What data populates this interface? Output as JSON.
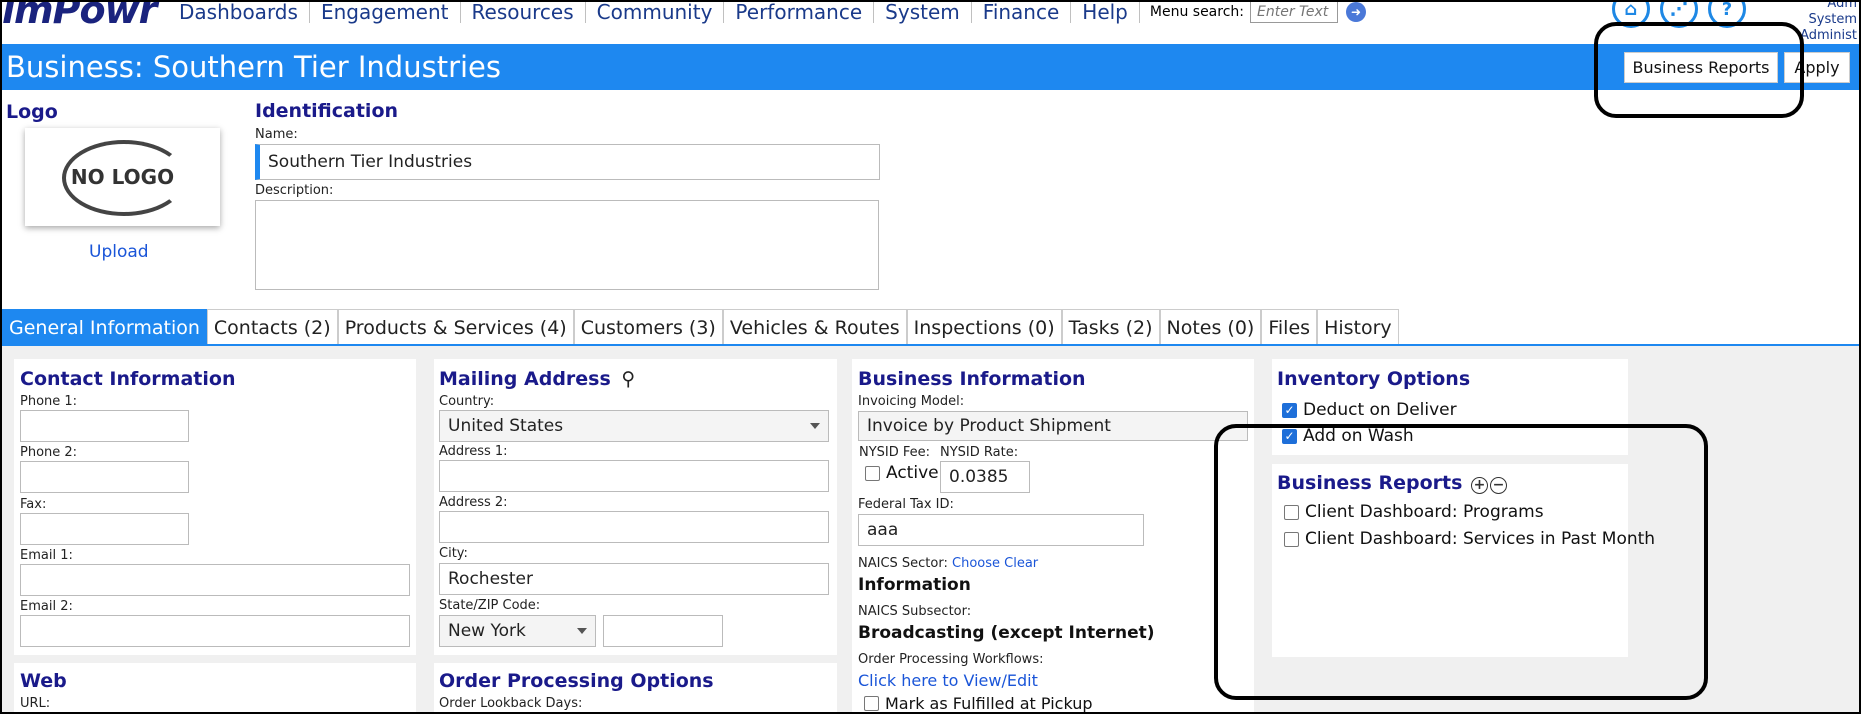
{
  "app": {
    "brand": "ımPowr"
  },
  "nav": {
    "items": [
      "Dashboards",
      "Engagement",
      "Resources",
      "Community",
      "Performance",
      "System",
      "Finance",
      "Help"
    ],
    "menu_search_label": "Menu search:",
    "menu_search_placeholder": "Enter Text"
  },
  "user": {
    "line1": "Adm",
    "line2": "System Administ"
  },
  "titlebar": {
    "title": "Business: Southern Tier Industries",
    "business_reports_button": "Business Reports",
    "apply_button": "Apply"
  },
  "logo_section": {
    "heading": "Logo",
    "placeholder_text": "NO LOGO",
    "upload_link": "Upload"
  },
  "identification": {
    "heading": "Identification",
    "name_label": "Name:",
    "name_value": "Southern Tier Industries",
    "description_label": "Description:",
    "description_value": ""
  },
  "tabs": [
    "General Information",
    "Contacts (2)",
    "Products & Services (4)",
    "Customers (3)",
    "Vehicles & Routes",
    "Inspections (0)",
    "Tasks (2)",
    "Notes (0)",
    "Files",
    "History"
  ],
  "contact_info": {
    "heading": "Contact Information",
    "phone1_label": "Phone 1:",
    "phone1": "",
    "phone2_label": "Phone 2:",
    "phone2": "",
    "fax_label": "Fax:",
    "fax": "",
    "email1_label": "Email 1:",
    "email1": "",
    "email2_label": "Email 2:",
    "email2": ""
  },
  "web": {
    "heading": "Web",
    "url_label": "URL:"
  },
  "mailing_address": {
    "heading": "Mailing Address",
    "country_label": "Country:",
    "country": "United States",
    "address1_label": "Address 1:",
    "address1": "",
    "address2_label": "Address 2:",
    "address2": "",
    "city_label": "City:",
    "city": "Rochester",
    "state_zip_label": "State/ZIP Code:",
    "state": "New York",
    "zip": ""
  },
  "order_processing": {
    "heading": "Order Processing Options",
    "lookback_label": "Order Lookback Days:"
  },
  "business_info": {
    "heading": "Business Information",
    "invoicing_label": "Invoicing Model:",
    "invoicing_value": "Invoice by Product Shipment",
    "nysid_fee_label": "NYSID Fee:",
    "nysid_active_label": "Active",
    "nysid_rate_label": "NYSID Rate:",
    "nysid_rate_value": "0.0385",
    "federal_tax_label": "Federal Tax ID:",
    "federal_tax_value": "aaa",
    "naics_sector_label": "NAICS Sector:",
    "naics_choose": "Choose",
    "naics_clear": "Clear",
    "naics_sector_value": "Information",
    "naics_subsector_label": "NAICS Subsector:",
    "naics_subsector_value": "Broadcasting (except Internet)",
    "workflows_label": "Order Processing Workflows:",
    "workflows_link": "Click here to View/Edit",
    "fulfilled_label": "Mark as Fulfilled at Pickup"
  },
  "inventory_options": {
    "heading": "Inventory Options",
    "deduct_label": "Deduct on Deliver",
    "deduct_checked": true,
    "add_label": "Add on Wash",
    "add_checked": true
  },
  "business_reports": {
    "heading": "Business Reports",
    "items": [
      {
        "label": "Client Dashboard: Programs",
        "checked": false
      },
      {
        "label": "Client Dashboard: Services in Past Month",
        "checked": false
      }
    ]
  },
  "colors": {
    "primary_blue": "#1e88f0",
    "heading_navy": "#1a1a8a",
    "link_blue": "#1a55d8"
  }
}
